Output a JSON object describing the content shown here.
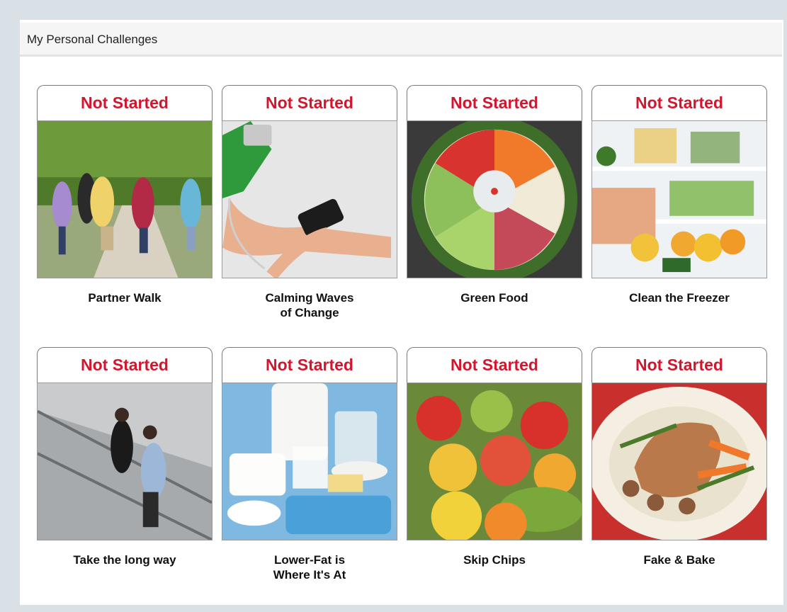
{
  "panel": {
    "title": "My Personal Challenges"
  },
  "colors": {
    "status_text": "#d1162e",
    "page_bg": "#d9e0e6"
  },
  "challenges": [
    {
      "status": "Not Started",
      "title": "Partner Walk",
      "image_icon": "walking-group-photo"
    },
    {
      "status": "Not Started",
      "title": "Calming Waves\nof Change",
      "image_icon": "blood-pressure-photo"
    },
    {
      "status": "Not Started",
      "title": "Green Food",
      "image_icon": "veggie-platter-photo"
    },
    {
      "status": "Not Started",
      "title": "Clean the Freezer",
      "image_icon": "fridge-photo"
    },
    {
      "status": "Not Started",
      "title": "Take the long way",
      "image_icon": "stairs-photo"
    },
    {
      "status": "Not Started",
      "title": "Lower-Fat is\nWhere It's At",
      "image_icon": "dairy-photo"
    },
    {
      "status": "Not Started",
      "title": "Skip Chips",
      "image_icon": "fruit-photo"
    },
    {
      "status": "Not Started",
      "title": "Fake & Bake",
      "image_icon": "chicken-dish-photo"
    }
  ]
}
